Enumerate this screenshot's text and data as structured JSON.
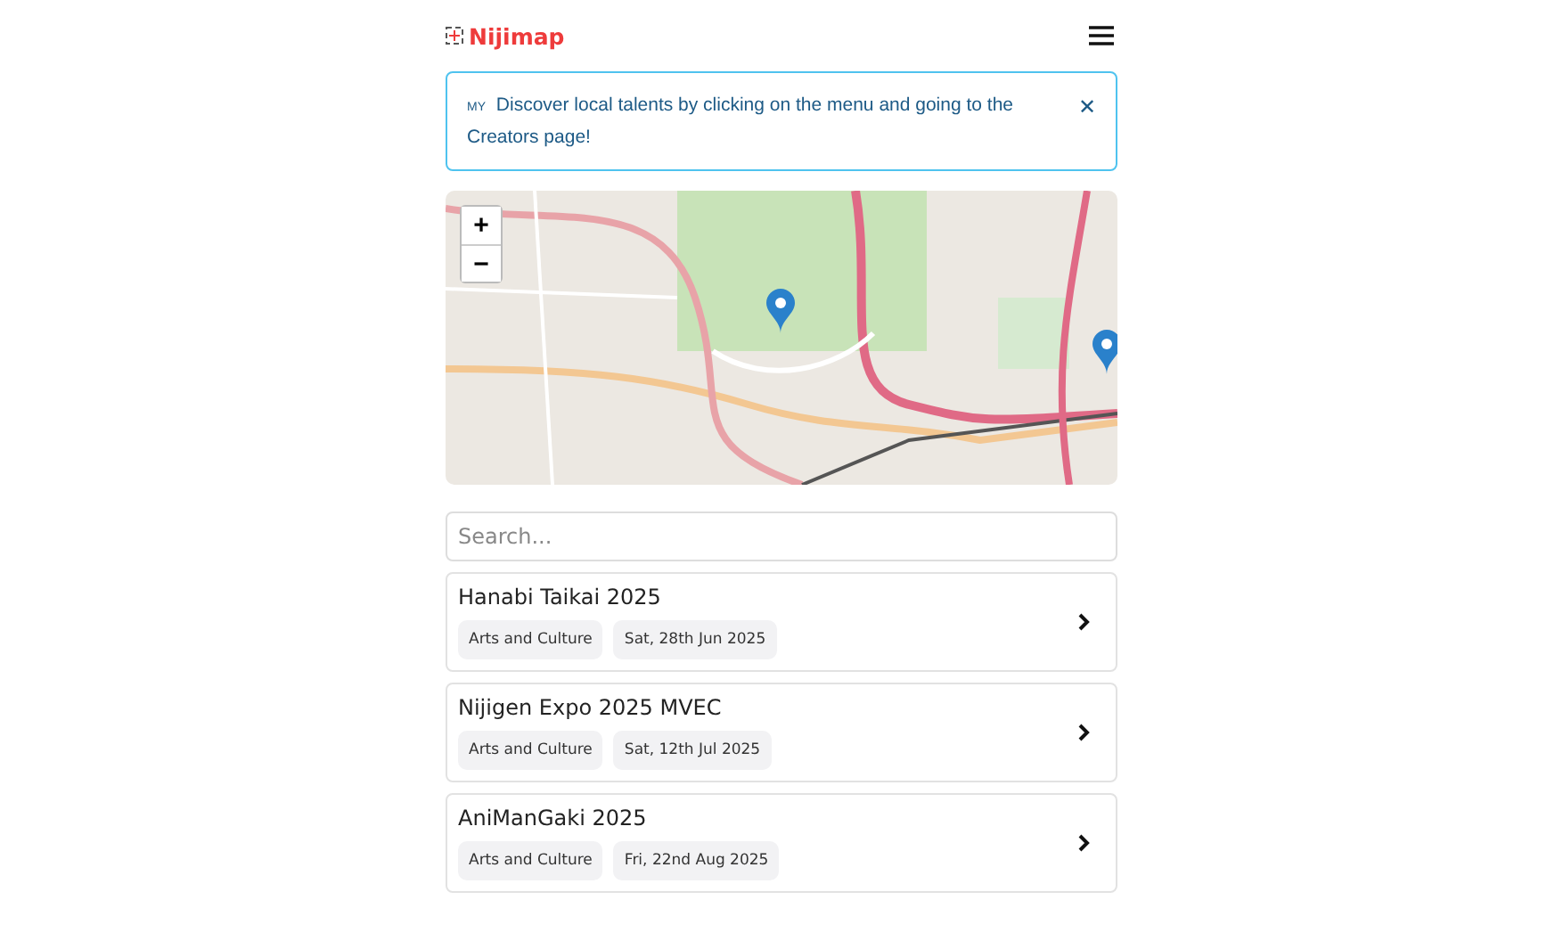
{
  "header": {
    "brand": "Nijimap"
  },
  "alert": {
    "flag": "MY",
    "message": "Discover local talents by clicking on the menu and going to the Creators page!",
    "close": "✕"
  },
  "map": {
    "zoom_in": "+",
    "zoom_out": "−"
  },
  "search": {
    "placeholder": "Search..."
  },
  "events": [
    {
      "title": "Hanabi Taikai 2025",
      "tags": [
        "Arts and Culture",
        "Sat, 28th Jun 2025"
      ]
    },
    {
      "title": "Nijigen Expo 2025 MVEC",
      "tags": [
        "Arts and Culture",
        "Sat, 12th Jul 2025"
      ]
    },
    {
      "title": "AniManGaki 2025",
      "tags": [
        "Arts and Culture",
        "Fri, 22nd Aug 2025"
      ]
    }
  ]
}
